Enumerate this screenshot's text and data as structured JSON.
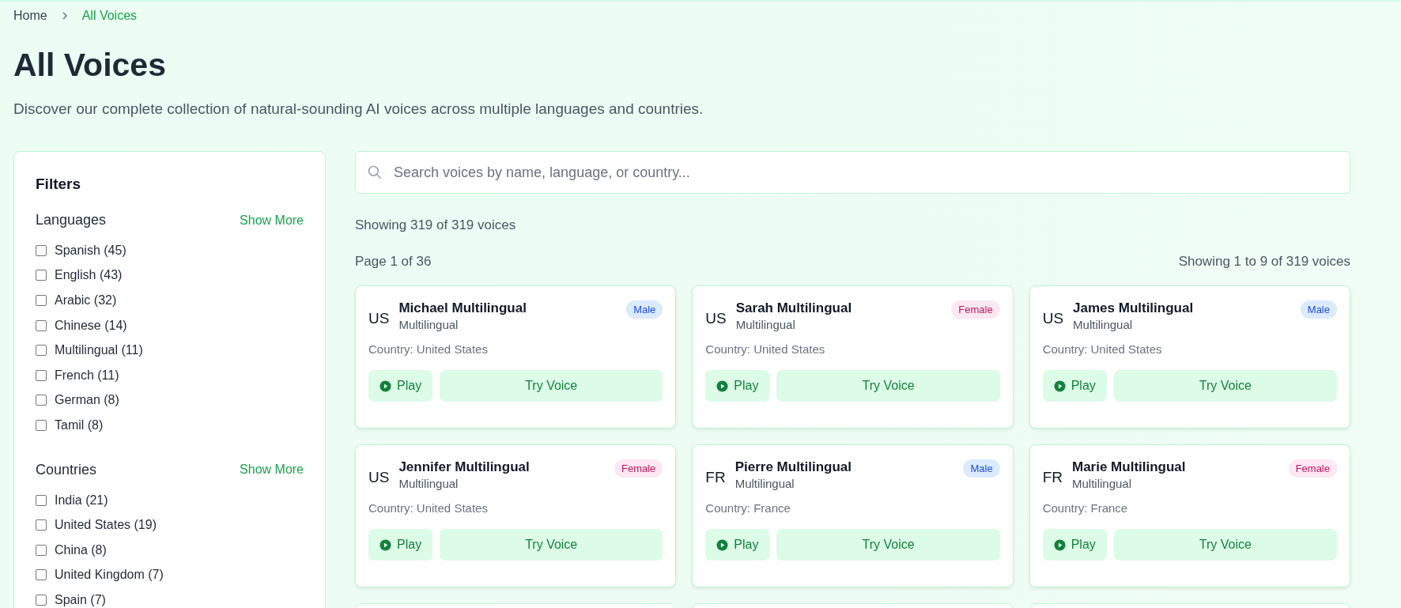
{
  "breadcrumb": [
    {
      "label": "Home",
      "selected": false
    },
    {
      "label": "All Voices",
      "selected": true
    }
  ],
  "title": "All Voices",
  "subtitle": "Discover our complete collection of natural-sounding AI voices across multiple languages and countries.",
  "filters": {
    "title": "Filters",
    "groups": [
      {
        "title": "Languages",
        "more": "Show More",
        "items": [
          {
            "label": "Spanish (45)",
            "checked": false
          },
          {
            "label": "English (43)",
            "checked": false
          },
          {
            "label": "Arabic (32)",
            "checked": false
          },
          {
            "label": "Chinese (14)",
            "checked": false
          },
          {
            "label": "Multilingual (11)",
            "checked": false
          },
          {
            "label": "French (11)",
            "checked": false
          },
          {
            "label": "German (8)",
            "checked": false
          },
          {
            "label": "Tamil (8)",
            "checked": false
          }
        ]
      },
      {
        "title": "Countries",
        "more": "Show More",
        "items": [
          {
            "label": "India (21)",
            "checked": false
          },
          {
            "label": "United States (19)",
            "checked": false
          },
          {
            "label": "China (8)",
            "checked": false
          },
          {
            "label": "United Kingdom (7)",
            "checked": false
          },
          {
            "label": "Spain (7)",
            "checked": false
          }
        ]
      }
    ]
  },
  "search": {
    "placeholder": "Search voices by name, language, or country..."
  },
  "total": "Showing 319 of 319 voices",
  "page": "Page 1 of 36",
  "range": "Showing 1 to 9 of 319 voices",
  "voices": [
    {
      "code": "US",
      "name": "Michael Multilingual",
      "language": "Multilingual",
      "gender": "Male",
      "kind": "male",
      "country": "Country: United States",
      "play": "Play",
      "try": "Try Voice"
    },
    {
      "code": "US",
      "name": "Sarah Multilingual",
      "language": "Multilingual",
      "gender": "Female",
      "kind": "female",
      "country": "Country: United States",
      "play": "Play",
      "try": "Try Voice"
    },
    {
      "code": "US",
      "name": "James Multilingual",
      "language": "Multilingual",
      "gender": "Male",
      "kind": "male",
      "country": "Country: United States",
      "play": "Play",
      "try": "Try Voice"
    },
    {
      "code": "US",
      "name": "Jennifer Multilingual",
      "language": "Multilingual",
      "gender": "Female",
      "kind": "female",
      "country": "Country: United States",
      "play": "Play",
      "try": "Try Voice"
    },
    {
      "code": "FR",
      "name": "Pierre Multilingual",
      "language": "Multilingual",
      "gender": "Male",
      "kind": "male",
      "country": "Country: France",
      "play": "Play",
      "try": "Try Voice"
    },
    {
      "code": "FR",
      "name": "Marie Multilingual",
      "language": "Multilingual",
      "gender": "Female",
      "kind": "female",
      "country": "Country: France",
      "play": "Play",
      "try": "Try Voice"
    }
  ]
}
